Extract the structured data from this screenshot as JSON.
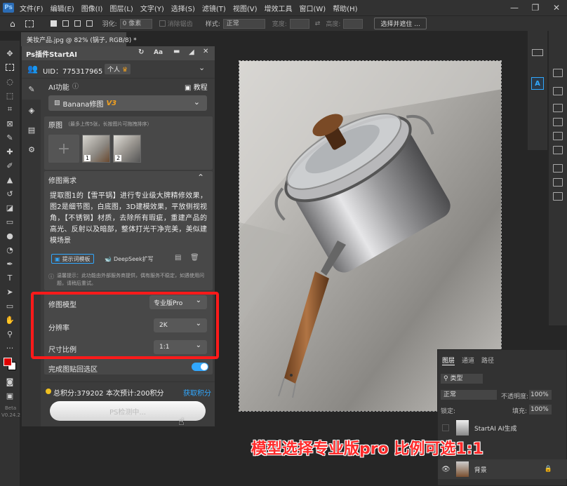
{
  "menu": [
    "文件(F)",
    "编辑(E)",
    "图像(I)",
    "图层(L)",
    "文字(Y)",
    "选择(S)",
    "滤镜(T)",
    "视图(V)",
    "增效工具",
    "窗口(W)",
    "帮助(H)"
  ],
  "app_logo": "Ps",
  "options": {
    "feather_label": "羽化:",
    "feather_value": "0 像素",
    "antialias_label": "消除锯齿",
    "style_label": "样式:",
    "style_value": "正常",
    "width_label": "宽度:",
    "height_label": "高度:",
    "select_mask_btn": "选择并遮住 ..."
  },
  "doc_tab": "美妆产品.jpg @ 82% (锅子, RGB/8) *",
  "plugin": {
    "title": "Ps插件StartAI",
    "uid": "UID：775317965",
    "account_type": "个人",
    "ai_function_label": "AI功能",
    "tutorial_label": "教程",
    "model_select": "Banana修图",
    "model_version": "V3",
    "original_label": "原图",
    "original_hint": "（最多上传5张，长按图片可拖拽排序）",
    "thumb_numbers": [
      "1",
      "2"
    ],
    "requirement_label": "修图需求",
    "prompt_text": "提取图1的【雪平锅】进行专业级大牌精修效果，图2是细节图，白底图，3D建模效果，平放侧视视角，【不锈钢】材质，去除所有瑕疵，重建产品的高光、反射以及暗部，整体打光干净完美，美似建模场景",
    "template_button": "提示词模板",
    "deepseek_button": "DeepSeek扩写",
    "notice": "温馨提示：此功能由外部服务商提供，偶有服务不稳定，如遇使用问题，请稍后重试。",
    "retouch_model_label": "修图模型",
    "retouch_model_value": "专业版Pro",
    "resolution_label": "分辨率",
    "resolution_value": "2K",
    "ratio_label": "尺寸比例",
    "ratio_value": "1:1",
    "paste_back_label": "完成图贴回选区",
    "paste_back_on": true,
    "points": "总积分:379202",
    "estimate": "本次预计:200积分",
    "get_points": "获取积分",
    "detect_button": "PS检测中...",
    "beta": "Beta",
    "version": "V0.24.2"
  },
  "layers": {
    "tabs": [
      "图层",
      "通道",
      "路径"
    ],
    "kind_label": "类型",
    "blend_mode": "正常",
    "opacity_label": "不透明度:",
    "opacity_value": "100%",
    "lock_label": "锁定:",
    "fill_label": "填充:",
    "fill_value": "100%",
    "items": [
      {
        "name": "StartAI AI生成"
      },
      {
        "name": "背景"
      }
    ]
  },
  "annotation": "模型选择专业版pro 比例可选1:1",
  "colors": {
    "accent": "#ff1a1a",
    "toggle": "#31a8ff",
    "version_badge": "#f0a020"
  }
}
